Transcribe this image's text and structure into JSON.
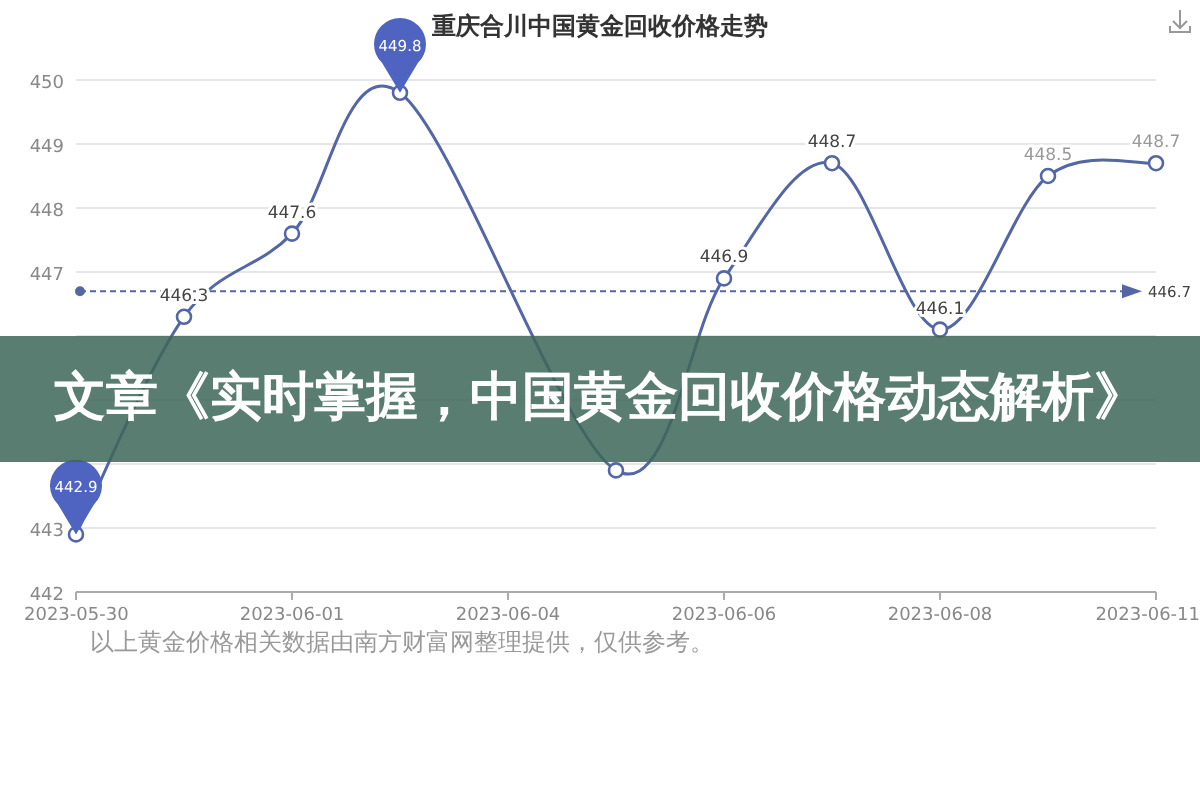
{
  "chart": {
    "title": "重庆合川中国黄金回收价格走势",
    "chart_data": {
      "type": "line",
      "categories": [
        "2023-05-30",
        null,
        "2023-06-01",
        null,
        "2023-06-04",
        null,
        "2023-06-06",
        null,
        "2023-06-08",
        null,
        "2023-06-11"
      ],
      "yticks": [
        442,
        443,
        447,
        448,
        449,
        450
      ],
      "ylim": [
        442,
        450
      ],
      "grid": true,
      "series": [
        {
          "color": "#5367a6",
          "marker": "circle",
          "values": [
            442.9,
            446.3,
            447.6,
            449.8,
            null,
            443.9,
            446.9,
            448.7,
            446.1,
            448.5,
            448.7
          ]
        }
      ],
      "value_labels": [
        null,
        "446.3",
        "447.6",
        null,
        null,
        null,
        "446.9",
        "448.7",
        "446.1",
        "448.5",
        "448.7"
      ],
      "annotations": [
        {
          "text": "449.8",
          "y": 449.8
        },
        {
          "text": "442.9",
          "y": 442.9
        }
      ],
      "ref_lines": [
        {
          "axis": "y",
          "value": 446.7,
          "label": "446.7"
        }
      ]
    }
  },
  "banner": {
    "title": "文章《实时掌握，中国黄金回收价格动态解析》"
  },
  "footnote": "以上黄金价格相关数据由南方财富网整理提供，仅供参考。"
}
